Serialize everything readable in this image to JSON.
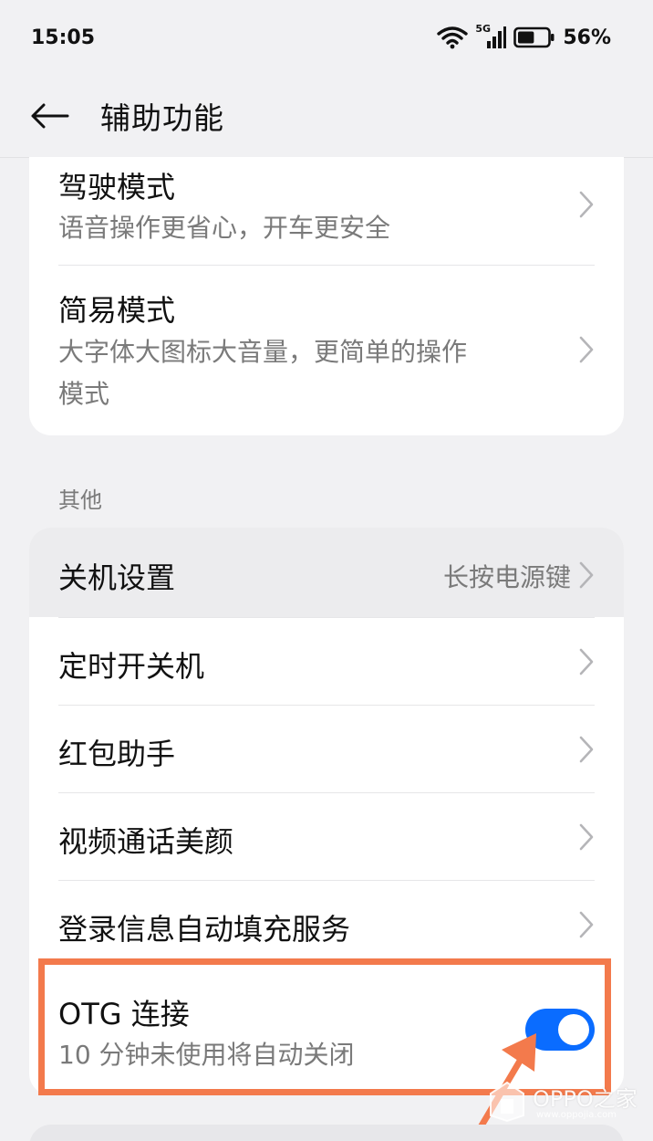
{
  "status_bar": {
    "time": "15:05",
    "network": "5G",
    "battery_percent": "56%",
    "battery_level": 0.56
  },
  "appbar": {
    "title": "辅助功能",
    "back_icon": "back-arrow-icon"
  },
  "top_card": {
    "items": [
      {
        "title": "驾驶模式",
        "subtitle": "语音操作更省心，开车更安全"
      },
      {
        "title": "简易模式",
        "subtitle_line1": "大字体大图标大音量，更简单的操作",
        "subtitle_line2": "模式"
      }
    ]
  },
  "other_section": {
    "label": "其他",
    "items": [
      {
        "title": "关机设置",
        "value": "长按电源键"
      },
      {
        "title": "定时开关机"
      },
      {
        "title": "红包助手"
      },
      {
        "title": "视频通话美颜"
      },
      {
        "title": "登录信息自动填充服务"
      }
    ],
    "otg": {
      "title": "OTG 连接",
      "subtitle": "10 分钟未使用将自动关闭",
      "enabled": true
    }
  },
  "watermark": {
    "brand": "OPPO之家",
    "url": "www.oppojia.com"
  },
  "colors": {
    "accent": "#0a6cff",
    "highlight": "#f37a4c",
    "background": "#f1f1f3"
  }
}
